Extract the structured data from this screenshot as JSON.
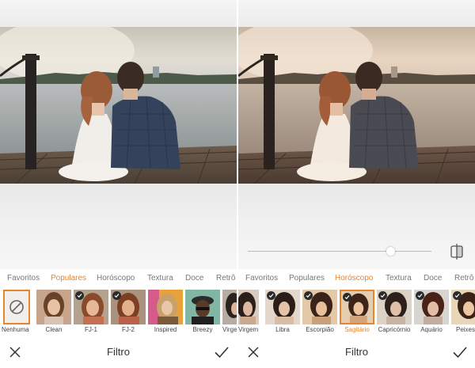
{
  "left": {
    "tabs": [
      {
        "label": "Favoritos",
        "active": false
      },
      {
        "label": "Populares",
        "active": true
      },
      {
        "label": "Horóscopo",
        "active": false
      },
      {
        "label": "Textura",
        "active": false
      },
      {
        "label": "Doce",
        "active": false
      },
      {
        "label": "Retrô",
        "active": false
      }
    ],
    "filters": [
      {
        "label": "Nenhuma",
        "icon": "no-filter-icon",
        "selected": true,
        "checked": false
      },
      {
        "label": "Clean",
        "checked": false
      },
      {
        "label": "FJ-1",
        "checked": true
      },
      {
        "label": "FJ-2",
        "checked": true
      },
      {
        "label": "Inspired",
        "checked": false
      },
      {
        "label": "Breezy",
        "checked": false
      },
      {
        "label": "Virgem",
        "checked": false
      }
    ],
    "bottom": {
      "title": "Filtro",
      "close_icon": "close-icon",
      "apply_icon": "checkmark-icon"
    }
  },
  "right": {
    "slider_value": 0.78,
    "compare_icon": "compare-icon",
    "tabs": [
      {
        "label": "Favoritos",
        "active": false
      },
      {
        "label": "Populares",
        "active": false
      },
      {
        "label": "Horóscopo",
        "active": true
      },
      {
        "label": "Textura",
        "active": false
      },
      {
        "label": "Doce",
        "active": false
      },
      {
        "label": "Retrô",
        "active": false
      }
    ],
    "filters": [
      {
        "label": "Virgem",
        "checked": false
      },
      {
        "label": "Libra",
        "checked": true
      },
      {
        "label": "Escorpião",
        "checked": true
      },
      {
        "label": "Sagitário",
        "checked": true,
        "active": true
      },
      {
        "label": "Capricórnio",
        "checked": true
      },
      {
        "label": "Aquário",
        "checked": true
      },
      {
        "label": "Peixes",
        "checked": true
      }
    ],
    "bottom": {
      "title": "Filtro",
      "close_icon": "close-icon",
      "apply_icon": "checkmark-icon"
    }
  },
  "colors": {
    "accent": "#e6852d",
    "text": "#333333",
    "muted": "#777777"
  }
}
